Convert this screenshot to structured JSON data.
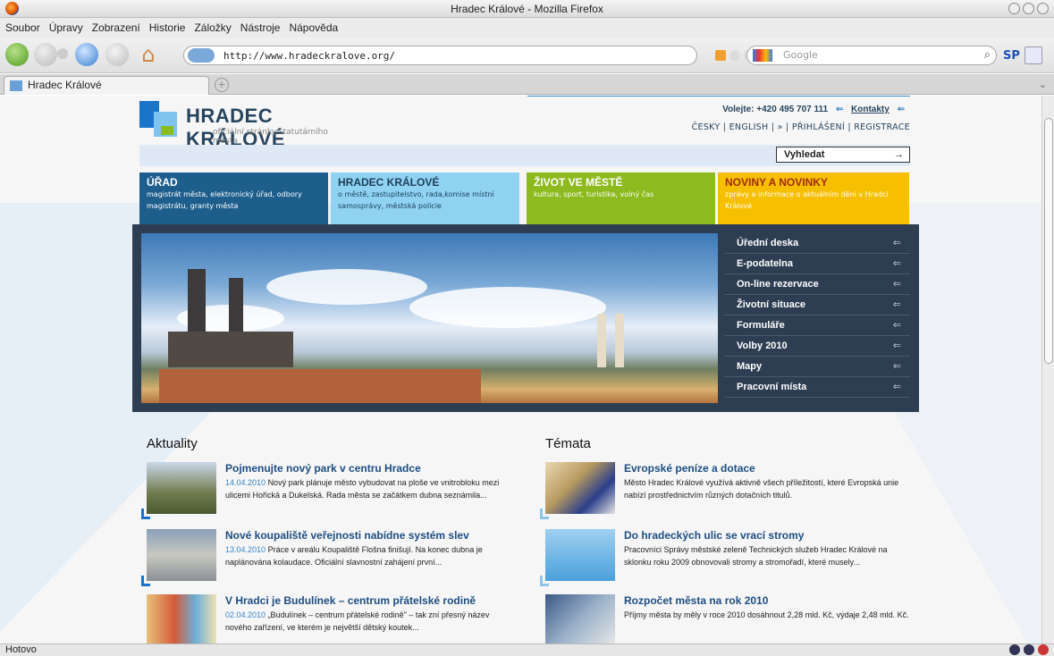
{
  "window": {
    "title": "Hradec Králové - Mozilla Firefox"
  },
  "menubar": [
    "Soubor",
    "Úpravy",
    "Zobrazení",
    "Historie",
    "Záložky",
    "Nástroje",
    "Nápověda"
  ],
  "navbar": {
    "url": "http://www.hradeckralove.org/",
    "search_placeholder": "Google",
    "sp_label": "SP"
  },
  "tab": {
    "title": "Hradec Králové"
  },
  "status": {
    "text": "Hotovo"
  },
  "site": {
    "logo_name": "HRADEC KRÁLOVÉ",
    "logo_sub": "oficiální stránky statutárního města",
    "contact_phone": "Volejte: +420 495 707 111",
    "contact_link": "Kontakty",
    "langs": "ČESKY | ENGLISH | » | PŘIHLÁŠENÍ | REGISTRACE",
    "search_button": "Vyhledat",
    "categories": [
      {
        "title": "ÚŘAD",
        "desc": "magistrát města, elektronický úřad, odbory magistrátu, granty města"
      },
      {
        "title": "HRADEC KRÁLOVÉ",
        "desc": "o městě, zastupitelstvo, rada,komise místní samosprávy, městská policie"
      },
      {
        "title": "ŽIVOT VE MĚSTĚ",
        "desc": "kultura, sport, turistika, volný čas"
      },
      {
        "title": "NOVINY A NOVINKY",
        "desc": "zprávy a informace o aktuálním dění v Hradci Králové"
      }
    ],
    "menu": [
      "Úřední deska",
      "E-podatelna",
      "On-line rezervace",
      "Životní situace",
      "Formuláře",
      "Volby 2010",
      "Mapy",
      "Pracovní místa"
    ],
    "news_title": "Aktuality",
    "topics_title": "Témata",
    "news": [
      {
        "title": "Pojmenujte nový park v centru Hradce",
        "date": "14.04.2010",
        "text": "Nový park plánuje město vybudovat na ploše ve vnitrobloku mezi ulicemi Hořická a Dukelská. Rada města se začátkem dubna seznámila..."
      },
      {
        "title": "Nové koupaliště veřejnosti nabídne systém slev",
        "date": "13.04.2010",
        "text": "Práce v areálu Koupaliště Flošna finišují. Na konec dubna je naplánována kolaudace. Oficiální slavnostní zahájení první..."
      },
      {
        "title": "V Hradci je Budulínek – centrum přátelské rodině",
        "date": "02.04.2010",
        "text": "„Budulínek – centrum přátelské rodině\" – tak zní přesný název nového zařízení, ve kterém je největší dětský koutek..."
      }
    ],
    "topics": [
      {
        "title": "Evropské peníze a dotace",
        "text": "Město Hradec Králové využívá aktivně všech příležitostí, které Evropská unie nabízí prostřednictvím různých dotačních titulů."
      },
      {
        "title": "Do hradeckých ulic se vrací stromy",
        "text": "Pracovníci Správy městské zeleně Technických služeb Hradec Králové na sklonku roku 2009 obnovovali stromy a stromořadí, které musely..."
      },
      {
        "title": "Rozpočet města na rok 2010",
        "text": "Příjmy města by měly v roce 2010 dosáhnout 2,28 mld. Kč, výdaje 2,48 mld. Kč."
      }
    ]
  },
  "colors": {
    "brand_dark": "#27455f",
    "urad": "#1e5e8d",
    "hradec": "#8fd2f2",
    "zivot": "#8dba1e",
    "noviny": "#f6bf00",
    "menu_bg": "#2e3e52"
  }
}
